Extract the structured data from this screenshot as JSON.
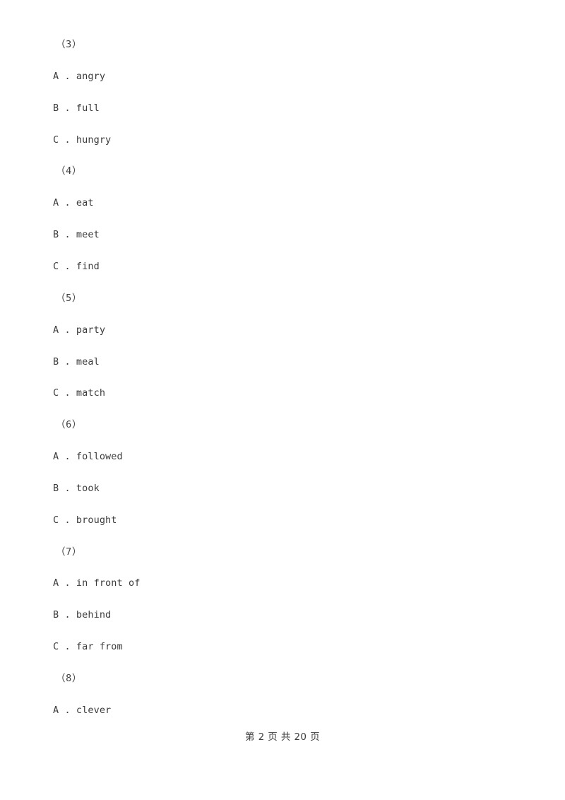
{
  "document": {
    "page_background": "#ffffff",
    "text_color": "#3b3b3b",
    "groups": [
      {
        "number_label": "（3）",
        "options": [
          {
            "letter": "A",
            "separator": " . ",
            "text": "angry"
          },
          {
            "letter": "B",
            "separator": " . ",
            "text": "full"
          },
          {
            "letter": "C",
            "separator": " . ",
            "text": "hungry"
          }
        ]
      },
      {
        "number_label": "（4）",
        "options": [
          {
            "letter": "A",
            "separator": " . ",
            "text": "eat"
          },
          {
            "letter": "B",
            "separator": " . ",
            "text": "meet"
          },
          {
            "letter": "C",
            "separator": " . ",
            "text": "find"
          }
        ]
      },
      {
        "number_label": "（5）",
        "options": [
          {
            "letter": "A",
            "separator": " . ",
            "text": "party"
          },
          {
            "letter": "B",
            "separator": " . ",
            "text": "meal"
          },
          {
            "letter": "C",
            "separator": " . ",
            "text": "match"
          }
        ]
      },
      {
        "number_label": "（6）",
        "options": [
          {
            "letter": "A",
            "separator": " . ",
            "text": "followed"
          },
          {
            "letter": "B",
            "separator": " . ",
            "text": "took"
          },
          {
            "letter": "C",
            "separator": " . ",
            "text": "brought"
          }
        ]
      },
      {
        "number_label": "（7）",
        "options": [
          {
            "letter": "A",
            "separator": " . ",
            "text": "in front of"
          },
          {
            "letter": "B",
            "separator": " . ",
            "text": "behind"
          },
          {
            "letter": "C",
            "separator": " . ",
            "text": "far from"
          }
        ]
      },
      {
        "number_label": "（8）",
        "options": [
          {
            "letter": "A",
            "separator": " . ",
            "text": "clever"
          }
        ]
      }
    ]
  },
  "footer": {
    "text": "第 2 页 共 20 页",
    "current_page": "2",
    "total_pages": "20"
  }
}
